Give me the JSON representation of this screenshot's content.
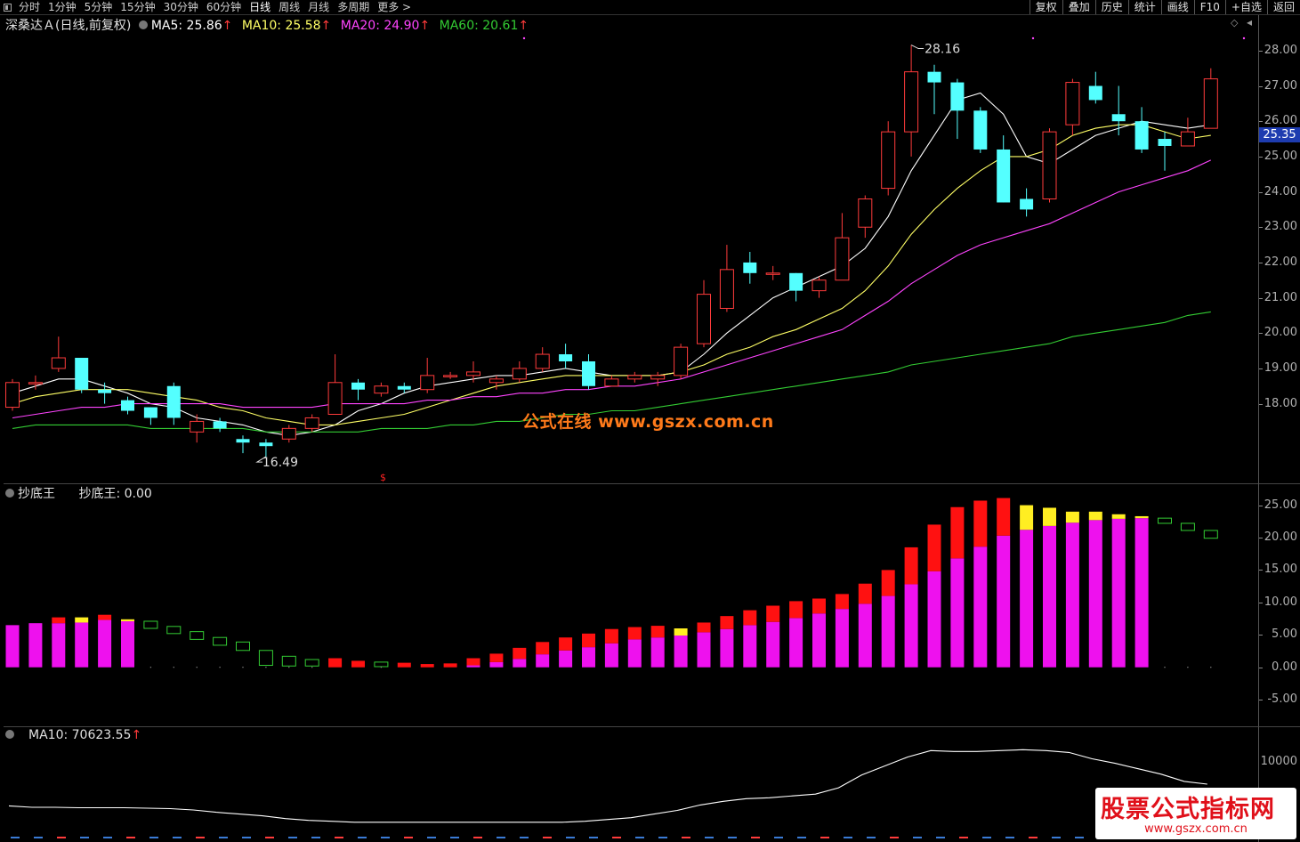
{
  "toolbar": {
    "periods": [
      "分时",
      "1分钟",
      "5分钟",
      "15分钟",
      "30分钟",
      "60分钟",
      "日线",
      "周线",
      "月线",
      "多周期",
      "更多 >"
    ],
    "active_period": "日线",
    "right_buttons": [
      "复权",
      "叠加",
      "历史",
      "统计",
      "画线",
      "F10",
      "+自选",
      "返回"
    ]
  },
  "colors": {
    "up": "#ff3b3b",
    "down": "#54ffff",
    "ma5": "#ffffff",
    "ma10": "#ffff66",
    "ma20": "#ff44ff",
    "ma60": "#33cc33",
    "bar_magenta": "#ee11ee",
    "bar_red": "#ff1111",
    "bar_yellow": "#ffee22",
    "bar_green_outline": "#33cc33"
  },
  "main_chart": {
    "stock_name": "深桑达Ａ",
    "mode": "(日线,前复权)",
    "ma5_label": "MA5: 25.86",
    "ma10_label": "MA10: 25.58",
    "ma20_label": "MA20: 24.90",
    "ma60_label": "MA60: 20.61",
    "up_arrow": "↑",
    "high_marker": "28.16",
    "low_marker": "16.49",
    "current_price": "25.35",
    "y_ticks": [
      "28.00",
      "27.00",
      "26.00",
      "25.00",
      "24.00",
      "23.00",
      "22.00",
      "21.00",
      "20.00",
      "19.00",
      "18.00"
    ],
    "watermark": "公式在线 www.gszx.com.cn"
  },
  "chart_data": [
    {
      "type": "candlestick",
      "title": "深桑达Ａ (日线,前复权)",
      "ylim": [
        16.2,
        28.4
      ],
      "candles": [
        {
          "o": 17.9,
          "c": 18.6,
          "h": 18.7,
          "l": 17.8
        },
        {
          "o": 18.6,
          "c": 18.6,
          "h": 18.8,
          "l": 18.4
        },
        {
          "o": 19.0,
          "c": 19.3,
          "h": 19.9,
          "l": 18.9
        },
        {
          "o": 19.3,
          "c": 18.4,
          "h": 19.3,
          "l": 18.3
        },
        {
          "o": 18.4,
          "c": 18.3,
          "h": 18.6,
          "l": 18.0
        },
        {
          "o": 18.1,
          "c": 17.8,
          "h": 18.2,
          "l": 17.7
        },
        {
          "o": 17.9,
          "c": 17.6,
          "h": 17.9,
          "l": 17.4
        },
        {
          "o": 18.5,
          "c": 17.6,
          "h": 18.6,
          "l": 17.4
        },
        {
          "o": 17.2,
          "c": 17.5,
          "h": 17.7,
          "l": 16.9
        },
        {
          "o": 17.5,
          "c": 17.3,
          "h": 17.6,
          "l": 17.2
        },
        {
          "o": 17.0,
          "c": 16.9,
          "h": 17.1,
          "l": 16.6
        },
        {
          "o": 16.9,
          "c": 16.8,
          "h": 17.0,
          "l": 16.5
        },
        {
          "o": 17.0,
          "c": 17.3,
          "h": 17.4,
          "l": 16.9
        },
        {
          "o": 17.3,
          "c": 17.6,
          "h": 17.7,
          "l": 17.2
        },
        {
          "o": 17.7,
          "c": 18.6,
          "h": 19.4,
          "l": 17.7
        },
        {
          "o": 18.6,
          "c": 18.4,
          "h": 18.7,
          "l": 18.1
        },
        {
          "o": 18.3,
          "c": 18.5,
          "h": 18.6,
          "l": 18.2
        },
        {
          "o": 18.5,
          "c": 18.4,
          "h": 18.6,
          "l": 18.3
        },
        {
          "o": 18.4,
          "c": 18.8,
          "h": 19.3,
          "l": 18.3
        },
        {
          "o": 18.8,
          "c": 18.8,
          "h": 18.9,
          "l": 18.7
        },
        {
          "o": 18.8,
          "c": 18.9,
          "h": 19.2,
          "l": 18.6
        },
        {
          "o": 18.6,
          "c": 18.7,
          "h": 18.8,
          "l": 18.4
        },
        {
          "o": 18.7,
          "c": 19.0,
          "h": 19.2,
          "l": 18.6
        },
        {
          "o": 19.0,
          "c": 19.4,
          "h": 19.6,
          "l": 18.9
        },
        {
          "o": 19.4,
          "c": 19.2,
          "h": 19.7,
          "l": 19.0
        },
        {
          "o": 19.2,
          "c": 18.5,
          "h": 19.4,
          "l": 18.4
        },
        {
          "o": 18.5,
          "c": 18.7,
          "h": 18.8,
          "l": 18.5
        },
        {
          "o": 18.7,
          "c": 18.8,
          "h": 18.9,
          "l": 18.6
        },
        {
          "o": 18.7,
          "c": 18.8,
          "h": 18.9,
          "l": 18.5
        },
        {
          "o": 18.8,
          "c": 19.6,
          "h": 19.7,
          "l": 18.7
        },
        {
          "o": 19.7,
          "c": 21.1,
          "h": 21.5,
          "l": 19.6
        },
        {
          "o": 20.7,
          "c": 21.8,
          "h": 22.5,
          "l": 20.6
        },
        {
          "o": 22.0,
          "c": 21.7,
          "h": 22.3,
          "l": 21.4
        },
        {
          "o": 21.7,
          "c": 21.7,
          "h": 21.9,
          "l": 21.5
        },
        {
          "o": 21.7,
          "c": 21.2,
          "h": 21.7,
          "l": 20.9
        },
        {
          "o": 21.2,
          "c": 21.5,
          "h": 21.6,
          "l": 21.0
        },
        {
          "o": 21.5,
          "c": 22.7,
          "h": 23.4,
          "l": 21.5
        },
        {
          "o": 23.0,
          "c": 23.8,
          "h": 23.9,
          "l": 22.7
        },
        {
          "o": 24.1,
          "c": 25.7,
          "h": 26.0,
          "l": 23.9
        },
        {
          "o": 25.7,
          "c": 27.4,
          "h": 28.16,
          "l": 25.0
        },
        {
          "o": 27.4,
          "c": 27.1,
          "h": 27.6,
          "l": 26.2
        },
        {
          "o": 27.1,
          "c": 26.3,
          "h": 27.2,
          "l": 25.5
        },
        {
          "o": 26.3,
          "c": 25.2,
          "h": 26.4,
          "l": 25.1
        },
        {
          "o": 25.2,
          "c": 23.7,
          "h": 25.6,
          "l": 23.7
        },
        {
          "o": 23.8,
          "c": 23.5,
          "h": 24.1,
          "l": 23.3
        },
        {
          "o": 23.8,
          "c": 25.7,
          "h": 25.8,
          "l": 23.7
        },
        {
          "o": 25.9,
          "c": 27.1,
          "h": 27.2,
          "l": 25.6
        },
        {
          "o": 27.0,
          "c": 26.6,
          "h": 27.4,
          "l": 26.5
        },
        {
          "o": 26.2,
          "c": 26.0,
          "h": 27.0,
          "l": 25.6
        },
        {
          "o": 26.0,
          "c": 25.2,
          "h": 26.4,
          "l": 25.1
        },
        {
          "o": 25.5,
          "c": 25.3,
          "h": 25.7,
          "l": 24.6
        },
        {
          "o": 25.3,
          "c": 25.7,
          "h": 26.1,
          "l": 25.3
        },
        {
          "o": 25.8,
          "c": 27.2,
          "h": 27.5,
          "l": 25.8
        }
      ],
      "series": [
        {
          "name": "MA5",
          "values": [
            18.3,
            18.5,
            18.7,
            18.7,
            18.5,
            18.3,
            18.0,
            17.9,
            17.6,
            17.5,
            17.4,
            17.2,
            17.1,
            17.2,
            17.4,
            17.8,
            18.0,
            18.3,
            18.5,
            18.6,
            18.7,
            18.8,
            18.8,
            18.9,
            19.0,
            18.9,
            18.8,
            18.8,
            18.8,
            18.9,
            19.4,
            20.0,
            20.5,
            21.0,
            21.3,
            21.6,
            21.9,
            22.4,
            23.3,
            24.6,
            25.6,
            26.6,
            26.8,
            26.2,
            25.0,
            24.8,
            25.2,
            25.6,
            25.8,
            26.0,
            25.9,
            25.8,
            25.9
          ]
        },
        {
          "name": "MA10",
          "values": [
            18.0,
            18.2,
            18.3,
            18.4,
            18.4,
            18.4,
            18.3,
            18.2,
            18.1,
            17.9,
            17.8,
            17.6,
            17.5,
            17.4,
            17.4,
            17.5,
            17.6,
            17.7,
            17.9,
            18.1,
            18.3,
            18.5,
            18.6,
            18.7,
            18.8,
            18.8,
            18.8,
            18.8,
            18.8,
            18.9,
            19.1,
            19.4,
            19.6,
            19.9,
            20.1,
            20.4,
            20.7,
            21.2,
            21.9,
            22.8,
            23.5,
            24.1,
            24.6,
            25.0,
            25.0,
            25.2,
            25.6,
            25.8,
            25.9,
            25.9,
            25.7,
            25.5,
            25.6
          ]
        },
        {
          "name": "MA20",
          "values": [
            17.6,
            17.7,
            17.8,
            17.9,
            17.9,
            18.0,
            18.0,
            18.0,
            18.0,
            18.0,
            17.9,
            17.9,
            17.9,
            17.9,
            18.0,
            18.0,
            18.0,
            18.0,
            18.1,
            18.1,
            18.2,
            18.2,
            18.3,
            18.3,
            18.4,
            18.4,
            18.5,
            18.5,
            18.6,
            18.7,
            18.9,
            19.1,
            19.3,
            19.5,
            19.7,
            19.9,
            20.1,
            20.5,
            20.9,
            21.4,
            21.8,
            22.2,
            22.5,
            22.7,
            22.9,
            23.1,
            23.4,
            23.7,
            24.0,
            24.2,
            24.4,
            24.6,
            24.9
          ]
        },
        {
          "name": "MA60",
          "values": [
            17.3,
            17.4,
            17.4,
            17.4,
            17.4,
            17.4,
            17.3,
            17.3,
            17.3,
            17.3,
            17.3,
            17.2,
            17.2,
            17.2,
            17.2,
            17.2,
            17.3,
            17.3,
            17.3,
            17.4,
            17.4,
            17.5,
            17.5,
            17.6,
            17.7,
            17.7,
            17.8,
            17.8,
            17.9,
            18.0,
            18.1,
            18.2,
            18.3,
            18.4,
            18.5,
            18.6,
            18.7,
            18.8,
            18.9,
            19.1,
            19.2,
            19.3,
            19.4,
            19.5,
            19.6,
            19.7,
            19.9,
            20.0,
            20.1,
            20.2,
            20.3,
            20.5,
            20.6
          ]
        }
      ]
    },
    {
      "type": "bar",
      "title": "抄底王",
      "ylim": [
        -8,
        27
      ],
      "bars": [
        {
          "base": 6.5,
          "cap": 0,
          "kind": "red"
        },
        {
          "base": 6.8,
          "cap": 0,
          "kind": "red"
        },
        {
          "base": 6.8,
          "cap": 0.9,
          "kind": "red"
        },
        {
          "base": 6.9,
          "cap": 0.8,
          "kind": "yellow"
        },
        {
          "base": 7.3,
          "cap": 0.8,
          "kind": "red"
        },
        {
          "base": 7.1,
          "cap": 0.3,
          "kind": "yellow"
        },
        {
          "base": 0,
          "hollow": [
            6.0,
            7.1
          ]
        },
        {
          "base": 0,
          "hollow": [
            5.2,
            6.3
          ]
        },
        {
          "base": 0,
          "hollow": [
            4.3,
            5.5
          ]
        },
        {
          "base": 0,
          "hollow": [
            3.4,
            4.6
          ]
        },
        {
          "base": 0,
          "hollow": [
            2.6,
            3.9
          ]
        },
        {
          "base": 0,
          "hollow": [
            0.3,
            2.6
          ]
        },
        {
          "base": 0,
          "hollow": [
            0.2,
            1.7
          ]
        },
        {
          "base": 0,
          "hollow": [
            0.2,
            1.2
          ]
        },
        {
          "base": 0,
          "cap": 1.4,
          "kind": "red"
        },
        {
          "base": 0,
          "cap": 1.0,
          "kind": "red"
        },
        {
          "base": 0,
          "hollow": [
            0.1,
            0.8
          ]
        },
        {
          "base": 0,
          "cap": 0.7,
          "kind": "red"
        },
        {
          "base": 0,
          "cap": 0.5,
          "kind": "red"
        },
        {
          "base": 0,
          "cap": 0.6,
          "kind": "red"
        },
        {
          "base": 0.3,
          "cap": 1.1,
          "kind": "red"
        },
        {
          "base": 0.8,
          "cap": 1.3,
          "kind": "red"
        },
        {
          "base": 1.3,
          "cap": 1.7,
          "kind": "red"
        },
        {
          "base": 2.0,
          "cap": 1.9,
          "kind": "red"
        },
        {
          "base": 2.6,
          "cap": 2.0,
          "kind": "red"
        },
        {
          "base": 3.1,
          "cap": 2.1,
          "kind": "red"
        },
        {
          "base": 3.7,
          "cap": 2.2,
          "kind": "red"
        },
        {
          "base": 4.3,
          "cap": 1.9,
          "kind": "red"
        },
        {
          "base": 4.6,
          "cap": 1.8,
          "kind": "red"
        },
        {
          "base": 4.9,
          "cap": 1.1,
          "kind": "yellow"
        },
        {
          "base": 5.4,
          "cap": 1.5,
          "kind": "red"
        },
        {
          "base": 5.9,
          "cap": 2.0,
          "kind": "red"
        },
        {
          "base": 6.5,
          "cap": 2.3,
          "kind": "red"
        },
        {
          "base": 7.0,
          "cap": 2.5,
          "kind": "red"
        },
        {
          "base": 7.6,
          "cap": 2.6,
          "kind": "red"
        },
        {
          "base": 8.3,
          "cap": 2.3,
          "kind": "red"
        },
        {
          "base": 9.0,
          "cap": 2.3,
          "kind": "red"
        },
        {
          "base": 9.8,
          "cap": 3.1,
          "kind": "red"
        },
        {
          "base": 11.0,
          "cap": 4.0,
          "kind": "red"
        },
        {
          "base": 12.8,
          "cap": 5.7,
          "kind": "red"
        },
        {
          "base": 14.8,
          "cap": 7.2,
          "kind": "red"
        },
        {
          "base": 16.8,
          "cap": 7.9,
          "kind": "red"
        },
        {
          "base": 18.6,
          "cap": 7.1,
          "kind": "red"
        },
        {
          "base": 20.3,
          "cap": 5.8,
          "kind": "red"
        },
        {
          "base": 21.2,
          "cap": 3.8,
          "kind": "yellow"
        },
        {
          "base": 21.8,
          "cap": 2.8,
          "kind": "yellow"
        },
        {
          "base": 22.3,
          "cap": 1.7,
          "kind": "yellow"
        },
        {
          "base": 22.7,
          "cap": 1.3,
          "kind": "yellow"
        },
        {
          "base": 22.9,
          "cap": 0.7,
          "kind": "yellow"
        },
        {
          "base": 23.0,
          "cap": 0.3,
          "kind": "yellow"
        },
        {
          "base": 0,
          "hollow": [
            22.2,
            23.0
          ]
        },
        {
          "base": 0,
          "hollow": [
            21.1,
            22.2
          ]
        },
        {
          "base": 0,
          "hollow": [
            19.9,
            21.1
          ]
        }
      ]
    },
    {
      "type": "line",
      "title": "MA10",
      "ylim": [
        3000,
        14000
      ],
      "series": [
        {
          "name": "MA10",
          "values": [
            6100,
            5950,
            5950,
            5900,
            5900,
            5900,
            5850,
            5800,
            5650,
            5400,
            5200,
            5000,
            4700,
            4500,
            4400,
            4300,
            4300,
            4300,
            4300,
            4300,
            4300,
            4300,
            4300,
            4300,
            4300,
            4400,
            4600,
            4800,
            5200,
            5600,
            6200,
            6600,
            6900,
            7000,
            7200,
            7400,
            8100,
            9500,
            10500,
            11500,
            12200,
            12100,
            12100,
            12200,
            12300,
            12200,
            12000,
            11300,
            10800,
            10200,
            9600,
            8800,
            8500
          ]
        }
      ]
    }
  ],
  "indicator_panel": {
    "name": "抄底王",
    "value_label": "抄底王: 0.00",
    "y_ticks": [
      "25.00",
      "20.00",
      "15.00",
      "10.00",
      "5.00",
      "0.00",
      "-5.00"
    ]
  },
  "volume_panel": {
    "label": "MA10: 70623.55",
    "up_arrow": "↑",
    "y_tick": "10000"
  },
  "footer_watermark": "股票公式指标网",
  "footer_domain": "www.gszx.com.cn"
}
